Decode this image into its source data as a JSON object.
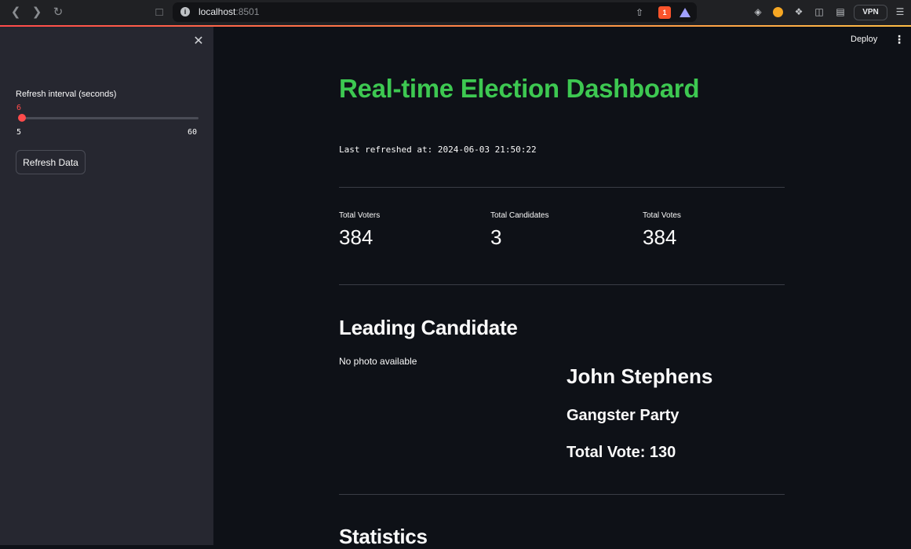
{
  "browser": {
    "host": "localhost",
    "port": ":8501",
    "vpn_label": "VPN",
    "brave_badge": "1"
  },
  "sidebar": {
    "slider_label": "Refresh interval (seconds)",
    "slider_value": "6",
    "slider_min": "5",
    "slider_max": "60",
    "slider_level": 6,
    "refresh_button_label": "Refresh Data"
  },
  "header": {
    "deploy_label": "Deploy"
  },
  "main": {
    "title": "Real-time Election Dashboard",
    "last_refreshed": "Last refreshed at: 2024-06-03 21:50:22",
    "metrics": [
      {
        "label": "Total Voters",
        "value": "384"
      },
      {
        "label": "Total Candidates",
        "value": "3"
      },
      {
        "label": "Total Votes",
        "value": "384"
      }
    ],
    "leading_section_title": "Leading Candidate",
    "no_photo_text": "No photo available",
    "candidate_name": "John Stephens",
    "party_name": "Gangster Party",
    "total_vote": "Total Vote: 130",
    "statistics_title": "Statistics"
  },
  "colors": {
    "accent": "#ff4b4b",
    "title_green": "#3dc851",
    "background": "#0e1117",
    "sidebar": "#262730"
  }
}
